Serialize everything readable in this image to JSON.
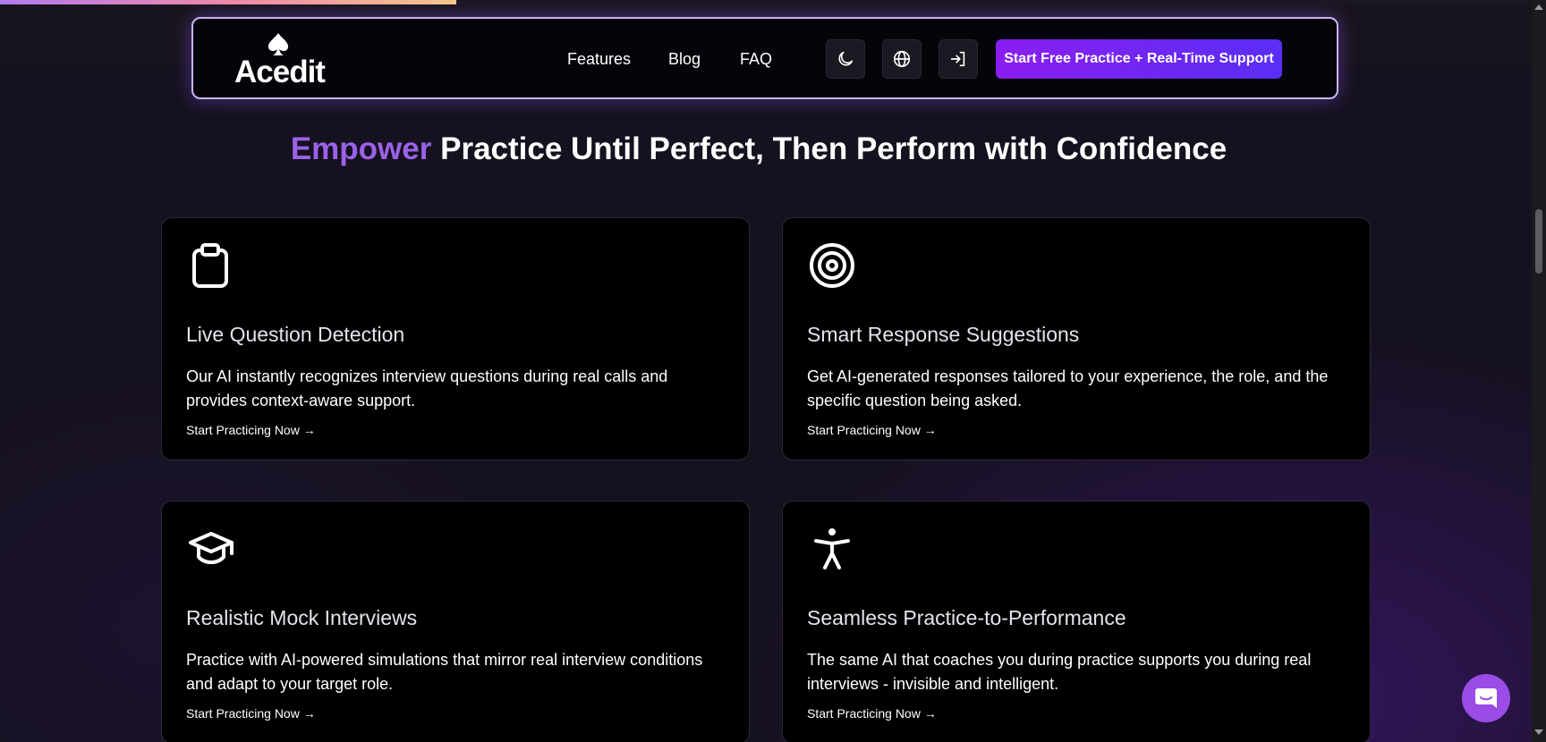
{
  "progress": {
    "fraction": 0.295
  },
  "nav": {
    "logo_text": "Acedit",
    "links": [
      "Features",
      "Blog",
      "FAQ"
    ],
    "theme_icon": "moon-icon",
    "language_icon": "globe-icon",
    "login_icon": "sign-in-icon",
    "cta_label": "Start Free Practice + Real-Time Support"
  },
  "headline": {
    "accent": "Empower",
    "rest": " Practice Until Perfect, Then Perform with Confidence"
  },
  "features": [
    {
      "icon": "clipboard-icon",
      "title": "Live Question Detection",
      "description": "Our AI instantly recognizes interview questions during real calls and provides context-aware support.",
      "link": "Start Practicing Now →"
    },
    {
      "icon": "target-icon",
      "title": "Smart Response Suggestions",
      "description": "Get AI-generated responses tailored to your experience, the role, and the specific question being asked.",
      "link": "Start Practicing Now →"
    },
    {
      "icon": "graduation-cap-icon",
      "title": "Realistic Mock Interviews",
      "description": "Practice with AI-powered simulations that mirror real interview conditions and adapt to your target role.",
      "link": "Start Practicing Now →"
    },
    {
      "icon": "accessibility-icon",
      "title": "Seamless Practice-to-Performance",
      "description": "The same AI that coaches you during practice supports you during real interviews - invisible and intelligent.",
      "link": "Start Practicing Now →"
    }
  ],
  "colors": {
    "accent_purple": "#9b62e8",
    "cta_start": "#8a1ef0",
    "cta_end": "#5a2ef5",
    "navbar_border": "#c9b4f5",
    "chat_button": "#9b4ce6"
  },
  "chat": {
    "icon": "chat-bubble-icon"
  }
}
